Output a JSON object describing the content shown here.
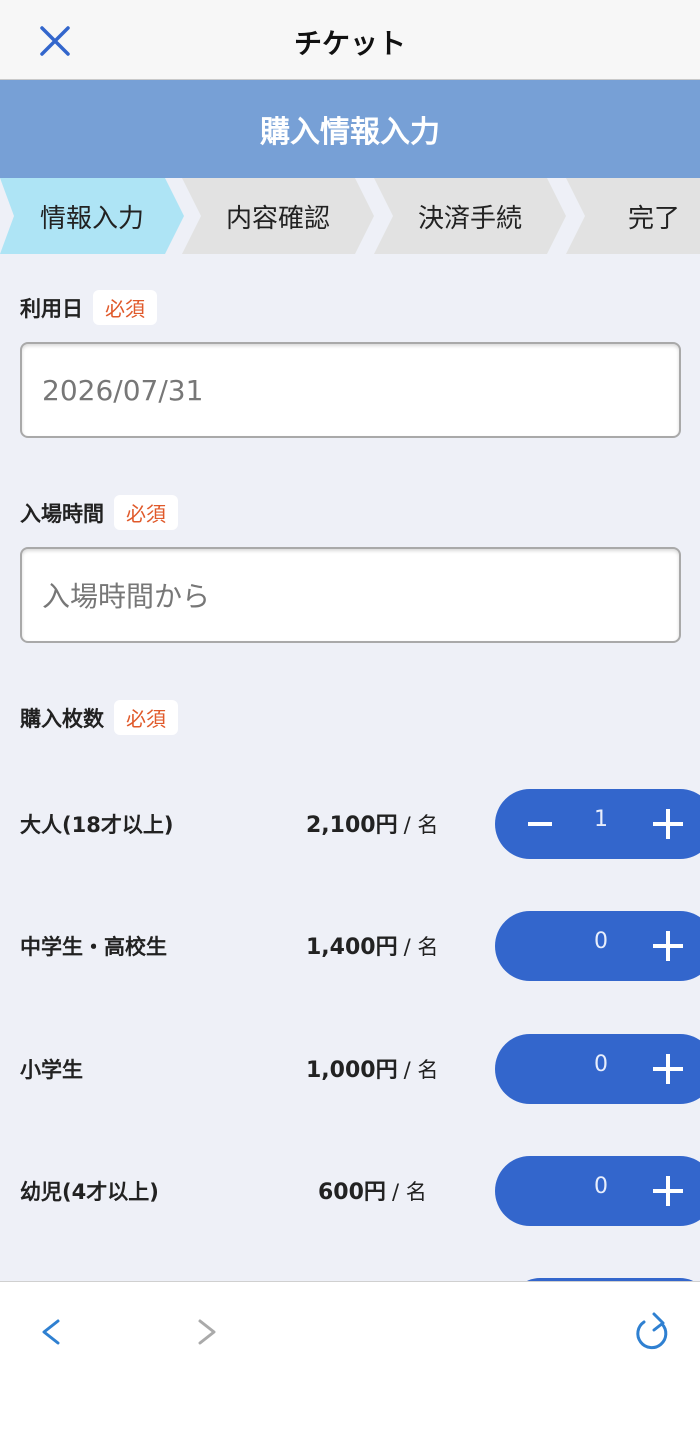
{
  "header": {
    "title": "チケット",
    "close_icon": "close-icon"
  },
  "banner": {
    "title": "購入情報入力"
  },
  "steps": [
    {
      "label": "情報入力",
      "active": true
    },
    {
      "label": "内容確認",
      "active": false
    },
    {
      "label": "決済手続",
      "active": false
    },
    {
      "label": "完了",
      "active": false
    }
  ],
  "form": {
    "required_badge": "必須",
    "date": {
      "label": "利用日",
      "value": "2026/07/31"
    },
    "time": {
      "label": "入場時間",
      "placeholder": "入場時間から"
    },
    "quantity": {
      "label": "購入枚数"
    }
  },
  "tickets": [
    {
      "name": "大人(18才以上)",
      "price": "2,100円",
      "unit": "/ 名",
      "qty": "1",
      "has_minus": true
    },
    {
      "name": "中学生・高校生",
      "price": "1,400円",
      "unit": "/ 名",
      "qty": "0",
      "has_minus": false
    },
    {
      "name": "小学生",
      "price": "1,000円",
      "unit": "/ 名",
      "qty": "0",
      "has_minus": false
    },
    {
      "name": "幼児(4才以上)",
      "price": "600円",
      "unit": "/ 名",
      "qty": "0",
      "has_minus": false
    }
  ],
  "colors": {
    "accent": "#3366cc",
    "banner": "#77a0d6",
    "active_step": "#aee4f5",
    "inactive_step": "#e2e2e2",
    "required": "#e0592a",
    "nav_blue": "#2f80d1",
    "nav_disabled": "#aaaaaa"
  }
}
